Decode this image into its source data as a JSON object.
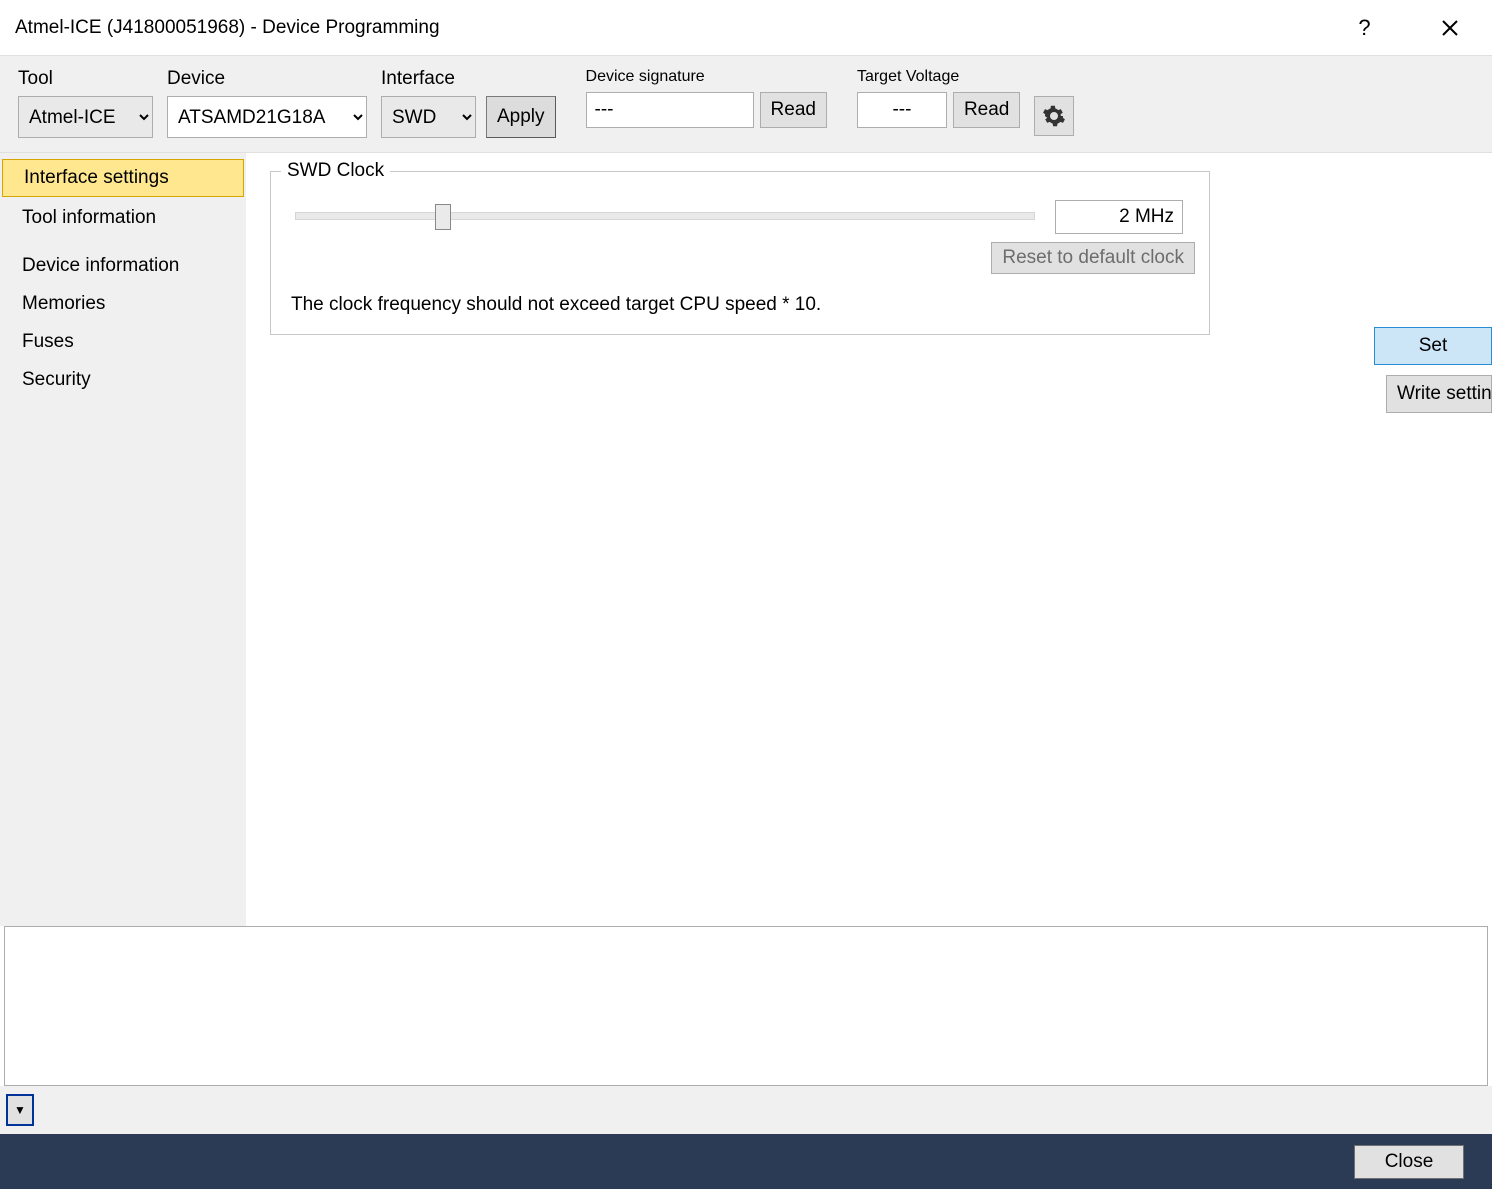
{
  "window": {
    "title": "Atmel-ICE (J41800051968) - Device Programming",
    "help": "?",
    "close": "✕"
  },
  "toolbar": {
    "tool_label": "Tool",
    "tool_value": "Atmel-ICE",
    "device_label": "Device",
    "device_value": "ATSAMD21G18A",
    "interface_label": "Interface",
    "interface_value": "SWD",
    "apply": "Apply",
    "sig_label": "Device signature",
    "sig_value": "---",
    "sig_read": "Read",
    "tv_label": "Target Voltage",
    "tv_value": "---",
    "tv_read": "Read"
  },
  "sidebar": {
    "items": [
      "Interface settings",
      "Tool information",
      "Device information",
      "Memories",
      "Fuses",
      "Security"
    ]
  },
  "swd": {
    "legend": "SWD Clock",
    "value": "2 MHz",
    "reset": "Reset to default clock",
    "note": "The clock frequency should not exceed target CPU speed * 10.",
    "set": "Set",
    "write": "Write settin"
  },
  "footer": {
    "close": "Close"
  }
}
